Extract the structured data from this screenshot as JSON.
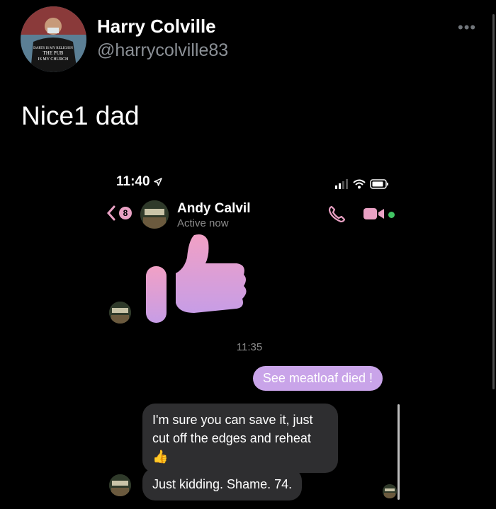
{
  "tweet": {
    "display_name": "Harry Colville",
    "handle": "@harrycolville83",
    "text": "Nice1 dad",
    "more_icon": "more-horizontal-icon",
    "shirt_text": "Darts is my religion The pub is my church"
  },
  "messenger": {
    "status_bar": {
      "time": "11:40",
      "location_icon": "location-arrow-icon"
    },
    "back_badge": "8",
    "contact_name": "Andy Calvil",
    "contact_status": "Active now",
    "accent_color": "#c9a4e9",
    "call_color": "#e9a1c4",
    "online_color": "#41c463",
    "time_separator": "11:35",
    "messages": [
      {
        "from": "me",
        "text": "See meatloaf died !"
      },
      {
        "from": "contact",
        "text": "I'm sure you can save it, just cut off the edges and reheat",
        "emoji": "👍"
      },
      {
        "from": "contact",
        "text": "Just kidding. Shame. 74."
      }
    ]
  }
}
